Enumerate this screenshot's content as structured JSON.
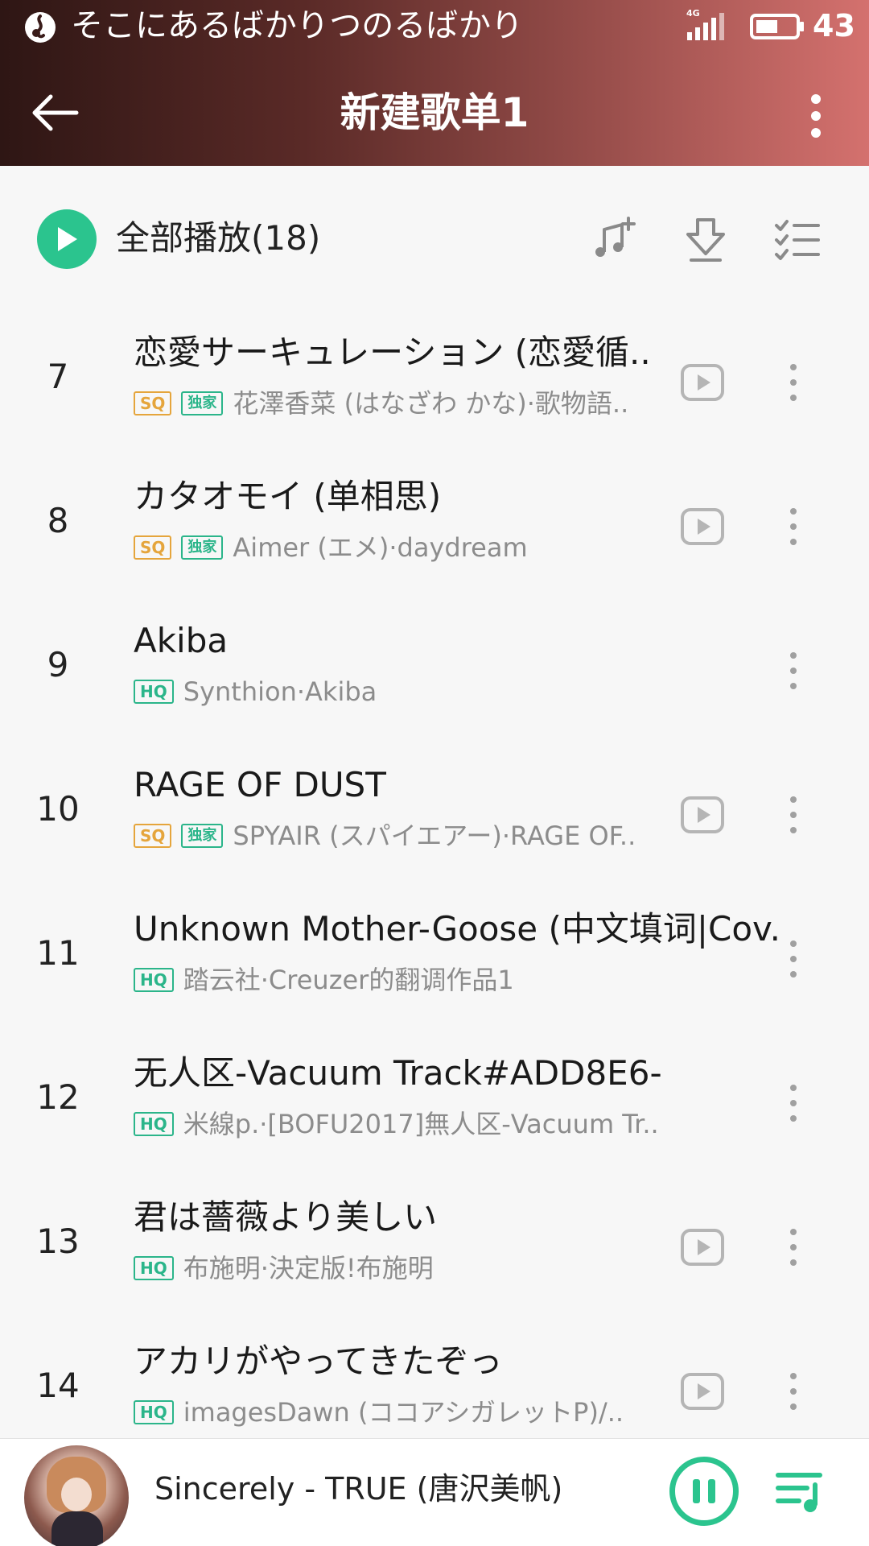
{
  "status_bar": {
    "app_title": "そこにあるばかりつのるばかり",
    "network_label": "4G",
    "battery_level": "43"
  },
  "header": {
    "title": "新建歌单1"
  },
  "play_all": {
    "label": "全部播放(18)"
  },
  "songs": [
    {
      "index": "7",
      "title": "恋愛サーキュレーション (恋愛循..",
      "artist": "花澤香菜 (はなざわ かな)·歌物語..",
      "quality": "SQ",
      "exclusive": "独家",
      "has_mv": true
    },
    {
      "index": "8",
      "title": "カタオモイ (单相思)",
      "artist": "Aimer (エメ)·daydream",
      "quality": "SQ",
      "exclusive": "独家",
      "has_mv": true
    },
    {
      "index": "9",
      "title": "Akiba",
      "artist": "Synthion·Akiba",
      "quality": "HQ",
      "exclusive": "",
      "has_mv": false
    },
    {
      "index": "10",
      "title": "RAGE OF DUST",
      "artist": "SPYAIR (スパイエアー)·RAGE OF..",
      "quality": "SQ",
      "exclusive": "独家",
      "has_mv": true
    },
    {
      "index": "11",
      "title": "Unknown Mother-Goose (中文填词|Cov..",
      "artist": "踏云社·Creuzer的翻调作品1",
      "quality": "HQ",
      "exclusive": "",
      "has_mv": false
    },
    {
      "index": "12",
      "title": "无人区-Vacuum Track#ADD8E6-",
      "artist": "米線p.·[BOFU2017]無人区-Vacuum Tr..",
      "quality": "HQ",
      "exclusive": "",
      "has_mv": false
    },
    {
      "index": "13",
      "title": "君は薔薇より美しい",
      "artist": "布施明·決定版!布施明",
      "quality": "HQ",
      "exclusive": "",
      "has_mv": true
    },
    {
      "index": "14",
      "title": "アカリがやってきたぞっ",
      "artist": "imagesDawn (ココアシガレットP)/..",
      "quality": "HQ",
      "exclusive": "",
      "has_mv": true
    }
  ],
  "player": {
    "now_playing": "Sincerely - TRUE (唐沢美帆)"
  },
  "colors": {
    "accent": "#2bc48e",
    "sq_badge": "#e5a53c",
    "hq_badge": "#2bb58a",
    "header_start": "#2e1614",
    "header_end": "#d4716e"
  },
  "icons": {
    "back": "arrow-left-icon",
    "more": "more-vertical-icon",
    "play_all": "play-circle-icon",
    "add_to_playlist": "music-add-icon",
    "download": "download-icon",
    "multi_select": "checklist-icon",
    "mv": "video-play-icon",
    "pause": "pause-icon",
    "playlist": "playlist-icon"
  }
}
